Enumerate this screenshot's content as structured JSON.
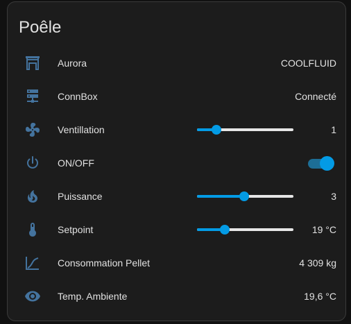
{
  "card": {
    "title": "Poêle",
    "icon_color": "#44739e",
    "accent_color": "#039be5"
  },
  "rows": [
    {
      "icon": "fireplace-icon",
      "label": "Aurora",
      "value": "COOLFLUID"
    },
    {
      "icon": "server-network-icon",
      "label": "ConnBox",
      "value": "Connecté"
    },
    {
      "icon": "fan-icon",
      "label": "Ventillation",
      "value": "1",
      "slider_fraction": 0.2
    },
    {
      "icon": "power-icon",
      "label": "ON/OFF",
      "toggle_on": true
    },
    {
      "icon": "fire-icon",
      "label": "Puissance",
      "value": "3",
      "slider_fraction": 0.49
    },
    {
      "icon": "thermometer-icon",
      "label": "Setpoint",
      "value": "19 °C",
      "slider_fraction": 0.29
    },
    {
      "icon": "chart-line-icon",
      "label": "Consommation Pellet",
      "value": "4 309 kg"
    },
    {
      "icon": "eye-icon",
      "label": "Temp. Ambiente",
      "value": "19,6 °C"
    }
  ]
}
